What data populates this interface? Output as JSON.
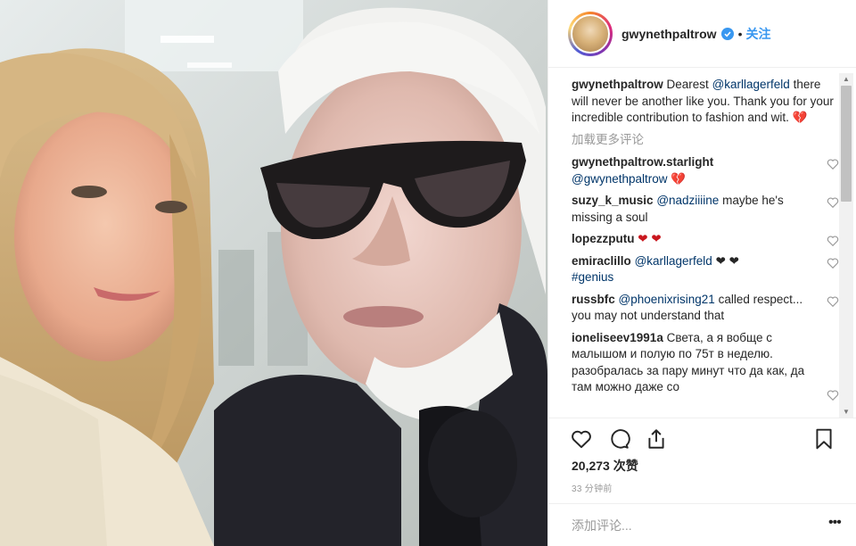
{
  "post": {
    "username": "gwynethpaltrow",
    "follow_label": "关注",
    "separator": "•",
    "caption": {
      "username": "gwynethpaltrow",
      "text_before": "Dearest ",
      "mention": "@karllagerfeld",
      "text_after": " there will never be another like you. Thank you for your incredible contribution to fashion and wit. ",
      "emoji": "💔"
    },
    "load_more_label": "加载更多评论",
    "comments": [
      {
        "username": "gwynethpaltrow.starlight",
        "mention": "@gwynethpaltrow",
        "text": "",
        "emoji": "💔",
        "emoji_color": "red"
      },
      {
        "username": "suzy_k_music",
        "mention": "@nadziiiine",
        "text": " maybe he's missing a soul",
        "emoji": "",
        "emoji_color": ""
      },
      {
        "username": "lopezzputu",
        "mention": "",
        "text": "",
        "emoji": "❤ ❤",
        "emoji_color": "red"
      },
      {
        "username": "emiraclillo",
        "mention": "@karllagerfeld",
        "text": "",
        "emoji": "❤ ❤",
        "emoji_color": "black",
        "tag": "#genius"
      },
      {
        "username": "russbfc",
        "mention": "@phoenixrising21",
        "text": " called respect... you may not understand that",
        "emoji": "",
        "emoji_color": ""
      },
      {
        "username": "ioneliseev1991a",
        "mention": "",
        "text": " Света, а я вобще с малышом и полую по 75т в неделю. разобралась за пару минут что да как, да там можно даже со",
        "emoji": "",
        "emoji_color": ""
      }
    ],
    "likes_label": "20,273 次赞",
    "timestamp": "33 分钟前",
    "add_comment_placeholder": "添加评论...",
    "more_dots": "•••"
  },
  "icons": [
    "verified-badge-icon",
    "heart-icon",
    "comment-icon",
    "share-icon",
    "bookmark-icon",
    "small-heart-icon",
    "scroll-up-icon",
    "scroll-down-icon"
  ],
  "colors": {
    "link": "#003569",
    "follow": "#3897f0",
    "muted": "#999999",
    "heart_red": "#c9171e"
  }
}
